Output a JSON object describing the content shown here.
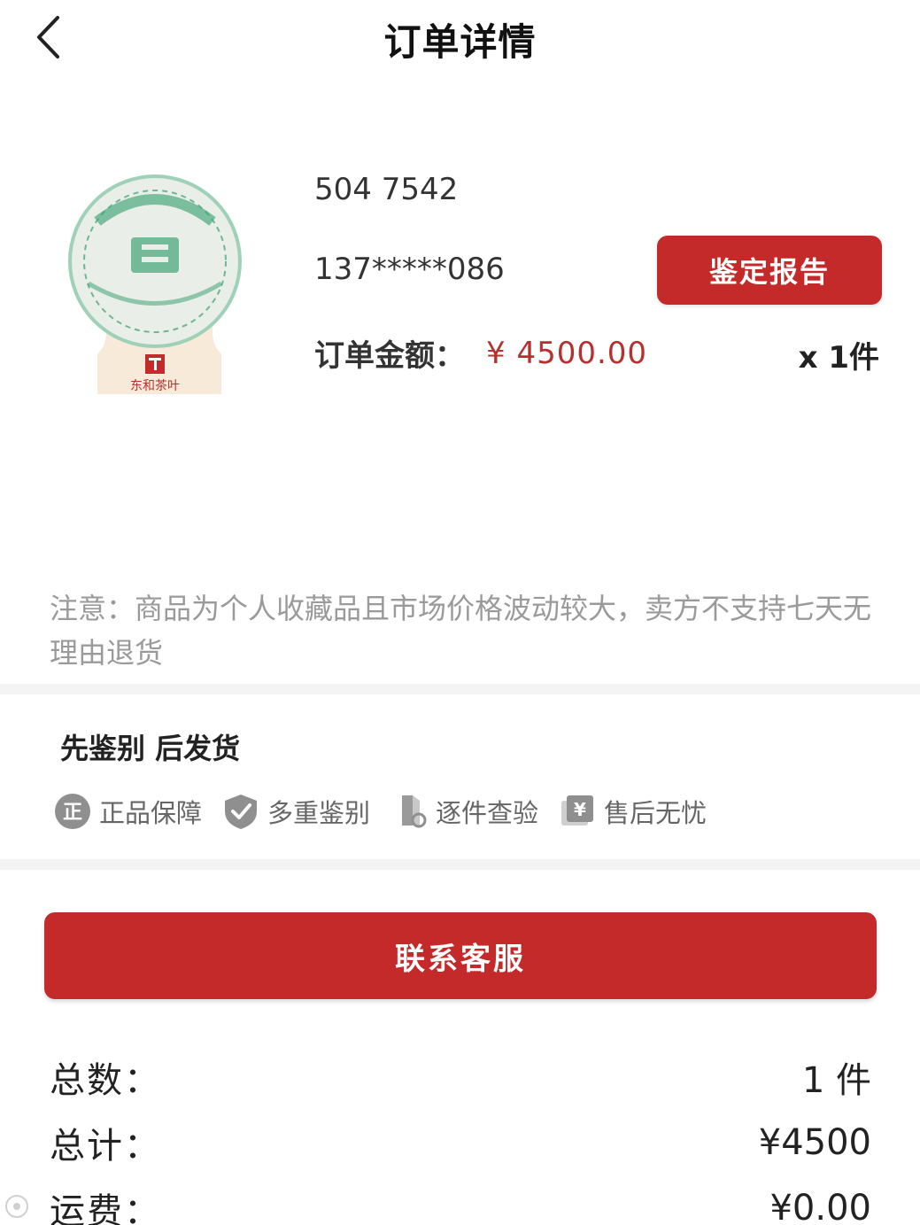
{
  "header": {
    "title": "订单详情"
  },
  "product": {
    "code": "504 7542",
    "phone": "137*****086",
    "report_button": "鉴定报告",
    "amount_label": "订单金额：",
    "amount_value": "¥ 4500.00",
    "quantity": "x 1件",
    "image_brand_text": "东和茶叶"
  },
  "notice": {
    "text": "注意：商品为个人收藏品且市场价格波动较大，卖方不支持七天无理由退货"
  },
  "guarantee": {
    "title": "先鉴别 后发货",
    "badges": [
      {
        "label": "正品保障",
        "icon": "authentic-icon"
      },
      {
        "label": "多重鉴别",
        "icon": "check-shield-icon"
      },
      {
        "label": "逐件查验",
        "icon": "inspect-icon"
      },
      {
        "label": "售后无忧",
        "icon": "yen-receipt-icon"
      }
    ]
  },
  "contact": {
    "label": "联系客服"
  },
  "summary": {
    "count_label": "总数：",
    "count_value": "1 件",
    "total_label": "总计：",
    "total_value": "¥4500",
    "shipping_label": "运费：",
    "shipping_value": "¥0.00"
  },
  "colors": {
    "accent": "#c42a2a",
    "price": "#b73030",
    "muted": "#9a9a9a"
  }
}
